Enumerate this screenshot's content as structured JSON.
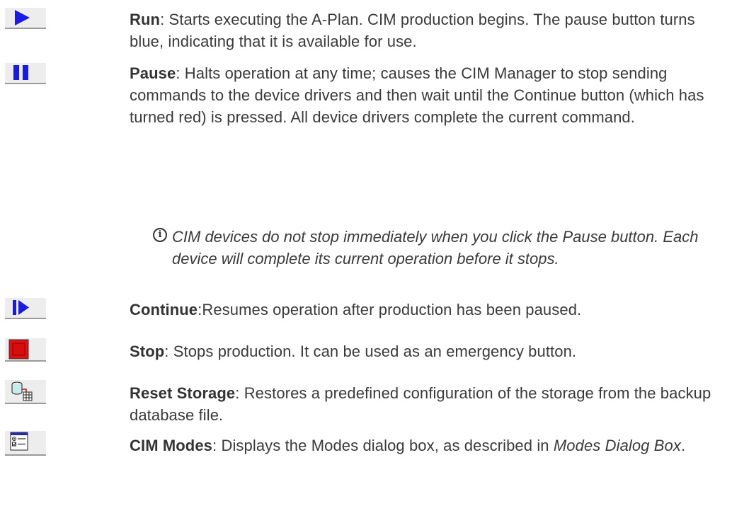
{
  "colors": {
    "blue": "#1a1ae6",
    "red": "#e01010",
    "text": "#3a3a3a"
  },
  "items": [
    {
      "icon": "play-icon",
      "term": "Run",
      "sep": ": ",
      "text": "Starts executing the A-Plan. CIM production begins. The pause button turns blue, indicating that it is available for use."
    },
    {
      "icon": "pause-icon",
      "term": "Pause",
      "sep": ": ",
      "text": "Halts operation at any time; causes the CIM Manager to stop sending commands to the device drivers and then wait until the Continue button (which has turned red) is pressed. All device drivers complete the current command."
    },
    {
      "icon": "continue-icon",
      "term": "Continue",
      "sep": ":",
      "text": "Resumes operation after production has been paused."
    },
    {
      "icon": "stop-icon",
      "term": "Stop",
      "sep": ": ",
      "text": "Stops production. It can be used as an emergency button."
    },
    {
      "icon": "reset-storage-icon",
      "term": "Reset Storage",
      "sep": ": ",
      "text": "Restores a predefined configuration of the storage from the backup database file."
    },
    {
      "icon": "cim-modes-icon",
      "term": "CIM Modes",
      "sep": ": ",
      "text": "Displays the Modes dialog box, as described in ",
      "link": "Modes Dialog Box",
      "end": "."
    }
  ],
  "note": {
    "icon": "info-icon",
    "glyph": "i",
    "text": "CIM devices do not stop immediately when you click the Pause button. Each device will complete its current operation before it stops."
  }
}
